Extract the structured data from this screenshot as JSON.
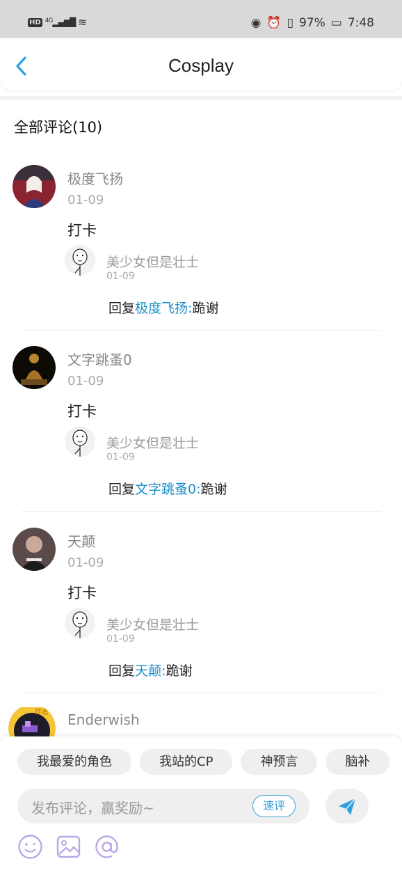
{
  "status_bar": {
    "hd": "HD",
    "network": "4G",
    "battery": "97%",
    "time": "7:48"
  },
  "header": {
    "title": "Cosplay"
  },
  "section": {
    "title": "全部评论(10)"
  },
  "comments": [
    {
      "name": "极度飞扬",
      "date": "01-09",
      "text": "打卡",
      "reply": {
        "name": "美少女但是壮士",
        "date": "01-09",
        "prefix": "回复",
        "target": "极度飞扬",
        "colon": ":",
        "body": "跪谢"
      }
    },
    {
      "name": "文字跳蚤0",
      "date": "01-09",
      "text": "打卡",
      "reply": {
        "name": "美少女但是壮士",
        "date": "01-09",
        "prefix": "回复",
        "target": "文字跳蚤0",
        "colon": ":",
        "body": "跪谢"
      }
    },
    {
      "name": "天颠",
      "date": "01-09",
      "text": "打卡",
      "reply": {
        "name": "美少女但是壮士",
        "date": "01-09",
        "prefix": "回复",
        "target": "天颠",
        "colon": ":",
        "body": "跪谢"
      }
    },
    {
      "name": "Enderwish",
      "badge": "作者"
    }
  ],
  "quick_tags": [
    "我最爱的角色",
    "我站的CP",
    "神预言",
    "脑补"
  ],
  "composer": {
    "placeholder": "发布评论，赢奖励~",
    "fast_label": "速评"
  },
  "colors": {
    "accent": "#1a8fc7",
    "send": "#2f9fe0",
    "tool": "#b9a6e6"
  },
  "icons": [
    "back-arrow-icon",
    "send-icon",
    "emoji-icon",
    "image-icon",
    "at-icon"
  ]
}
